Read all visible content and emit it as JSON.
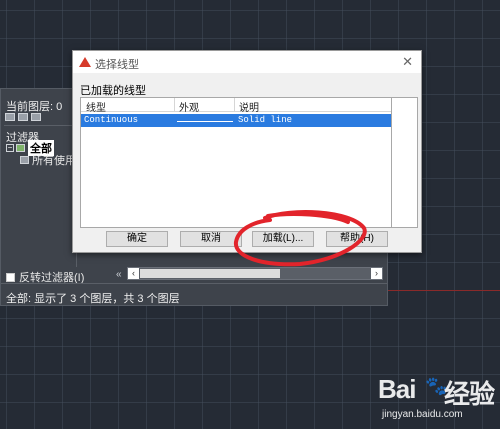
{
  "layer_panel": {
    "current_layer": "当前图层: 0",
    "filters_label": "过滤器",
    "tree_root": "全部",
    "tree_child": "所有使用",
    "invert_filter": "反转过滤器(I)",
    "collapse_glyph": "«",
    "status": "全部: 显示了 3 个图层，共 3 个图层"
  },
  "dialog": {
    "title": "选择线型",
    "close_glyph": "✕",
    "loaded_label": "已加载的线型",
    "columns": [
      "线型",
      "外观",
      "说明"
    ],
    "rows": [
      {
        "linetype": "Continuous",
        "description": "Solid line",
        "selected": true
      }
    ],
    "buttons": {
      "ok": "确定",
      "cancel": "取消",
      "load": "加载(L)...",
      "help": "帮助(H)"
    }
  },
  "colors": {
    "canvas": "#252b35",
    "selection": "#2a7be0",
    "annotation": "#e2242b",
    "app_icon": "#d63a2a"
  },
  "watermark": {
    "logo_text": "Bai 经验",
    "url": "jingyan.baidu.com"
  }
}
